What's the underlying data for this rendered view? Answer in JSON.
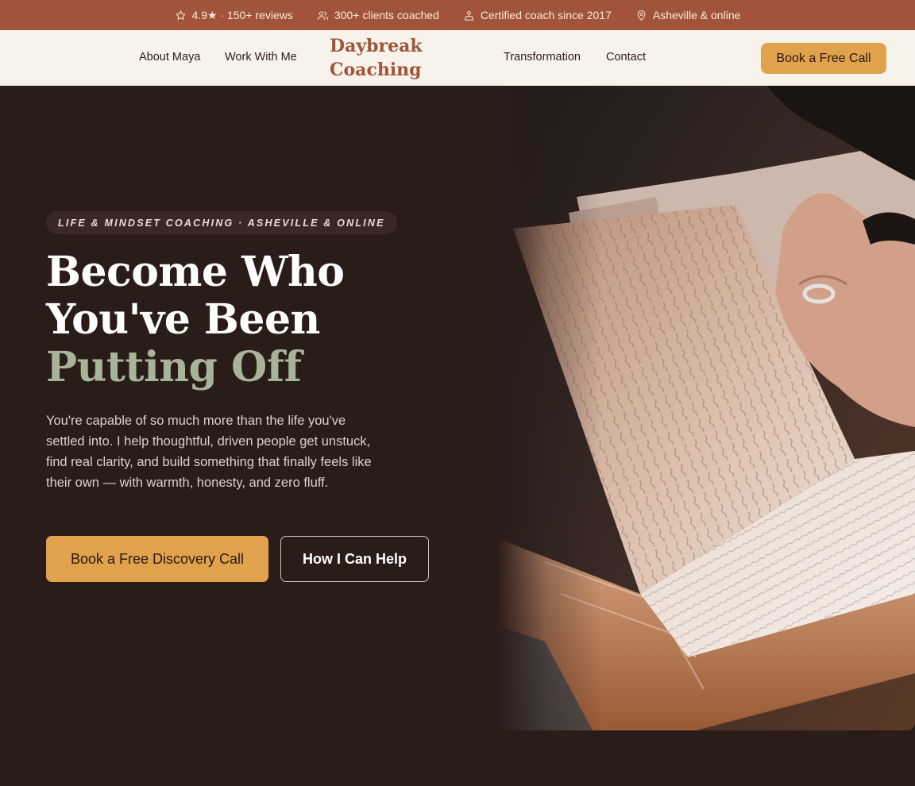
{
  "topbar": {
    "items": [
      {
        "icon": "star-icon",
        "text": "4.9★ · 150+ reviews"
      },
      {
        "icon": "users-icon",
        "text": "300+ clients coached"
      },
      {
        "icon": "certificate-icon",
        "text": "Certified coach since 2017"
      },
      {
        "icon": "location-pin-icon",
        "text": "Asheville & online"
      }
    ]
  },
  "nav": {
    "links": [
      "About Maya",
      "Work With Me",
      "Transformation",
      "Contact"
    ],
    "brand_line1": "Daybreak",
    "brand_line2": "Coaching",
    "cta": "Book a Free Call"
  },
  "hero": {
    "eyebrow": "LIFE & MINDSET COACHING · ASHEVILLE & ONLINE",
    "headline_line1": "Become Who",
    "headline_line2": "You've Been",
    "headline_accent": "Putting Off",
    "lede": "You're capable of so much more than the life you've settled into. I help thoughtful, driven people get unstuck, find real clarity, and build something that finally feels like their own — with warmth, honesty, and zero fluff.",
    "primary_cta": "Book a Free Discovery Call",
    "secondary_cta": "How I Can Help"
  },
  "colors": {
    "topbar": "#a1543a",
    "nav_bg": "#f8f3ea",
    "hero_bg": "#2a1c19",
    "accent_gold": "#e0a24d",
    "accent_sage": "#a8b49a",
    "brand": "#a1543a"
  }
}
